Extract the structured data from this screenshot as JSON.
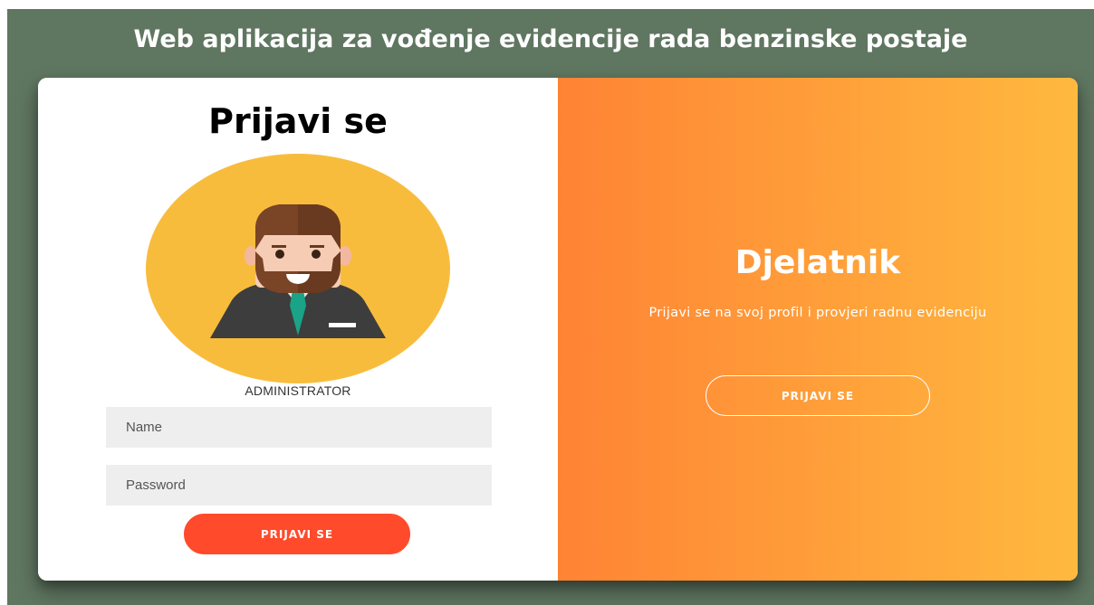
{
  "app": {
    "title": "Web aplikacija za vođenje evidencije rada benzinske postaje"
  },
  "login": {
    "heading": "Prijavi se",
    "avatar_icon": "businessman-avatar-icon",
    "role_label": "ADMINISTRATOR",
    "name_placeholder": "Name",
    "name_value": "",
    "password_placeholder": "Password",
    "password_value": "",
    "submit_label": "PRIJAVI SE"
  },
  "overlay": {
    "title": "Djelatnik",
    "text": "Prijavi se na svoj profil i provjeri radnu evidenciju",
    "button_label": "PRIJAVI SE"
  },
  "colors": {
    "background": "#5f7660",
    "primary_button": "#ff4b2b",
    "gradient_start": "#ff8334",
    "gradient_end": "#ffb93f",
    "avatar_circle": "#f8bc3d"
  }
}
